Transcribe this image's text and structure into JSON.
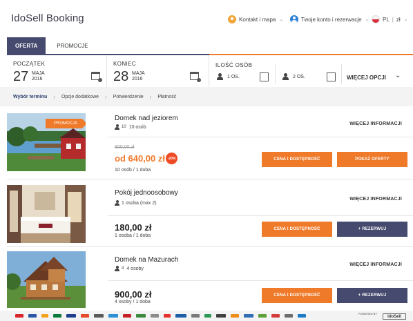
{
  "header": {
    "brand": "IdoSell Booking",
    "contact_label": "Kontakt i mapa",
    "account_label": "Twoje konto i rezerwacje",
    "lang_label": "PL",
    "currency_label": "zł"
  },
  "tabs": [
    {
      "label": "OFERTA",
      "active": true
    },
    {
      "label": "PROMOCJE",
      "active": false
    }
  ],
  "search": {
    "start": {
      "label": "POCZĄTEK",
      "day": "27",
      "month": "MAJA",
      "year": "2016"
    },
    "end": {
      "label": "KONIEC",
      "day": "28",
      "month": "MAJA",
      "year": "2016"
    },
    "persons": {
      "label": "ILOŚĆ OSÓB",
      "option1": "1 OS.",
      "option2": "2 OS.",
      "more": "WIĘCEJ OPCJI"
    }
  },
  "breadcrumbs": [
    "Wybór terminu",
    "Opcje dodatkowe",
    "Potwierdzenie",
    "Płatność"
  ],
  "offers": [
    {
      "name": "Domek nad jeziorem",
      "capacity_num": "10",
      "capacity_text": "10 osób",
      "promo_badge": "PROMOCJA",
      "old_price": "800,00 zł",
      "price": "od 640,00 zł",
      "discount": "-20%",
      "per": "10 osób / 1 doba",
      "info": "WIĘCEJ INFORMACJI",
      "btn1": "CENA I DOSTĘPNOŚĆ",
      "btn2": "POKAŻ OFERTY"
    },
    {
      "name": "Pokój jednoosobowy",
      "capacity_text": "1 osoba (max 2)",
      "price": "180,00 zł",
      "per": "1 osoba / 1 doba",
      "info": "WIĘCEJ INFORMACJI",
      "btn1": "CENA I DOSTĘPNOŚĆ",
      "btn2": "+ REZERWUJ"
    },
    {
      "name": "Domek na Mazurach",
      "capacity_num": "4",
      "capacity_text": "4 osoby",
      "price": "900,00 zł",
      "per": "4 osoby / 1 doba",
      "info": "WIĘCEJ INFORMACJI",
      "btn1": "CENA I DOSTĘPNOŚĆ",
      "btn2": "+ REZERWUJ"
    }
  ],
  "footer": {
    "powered_line1": "POWERED BY",
    "powered_line2": "IdoSell",
    "logo_colors": [
      "#d8262e",
      "#2a57a6",
      "#f4a11c",
      "#0a7a3c",
      "#1f3f8f",
      "#e14b2a",
      "#5a5a5a",
      "#2d8fd5",
      "#c62128",
      "#3b8a3e",
      "#8c8c8c",
      "#e5322d",
      "#1d5fa8",
      "#7a7a7a",
      "#2b9a57",
      "#404040",
      "#f08c1a",
      "#2f6db5",
      "#5b9f36",
      "#d43b3b",
      "#6d6d6d",
      "#1c7cc7"
    ]
  },
  "colors": {
    "accent_orange": "#ef7a2a",
    "navy": "#454a6e",
    "discount_red": "#ef4a24"
  }
}
